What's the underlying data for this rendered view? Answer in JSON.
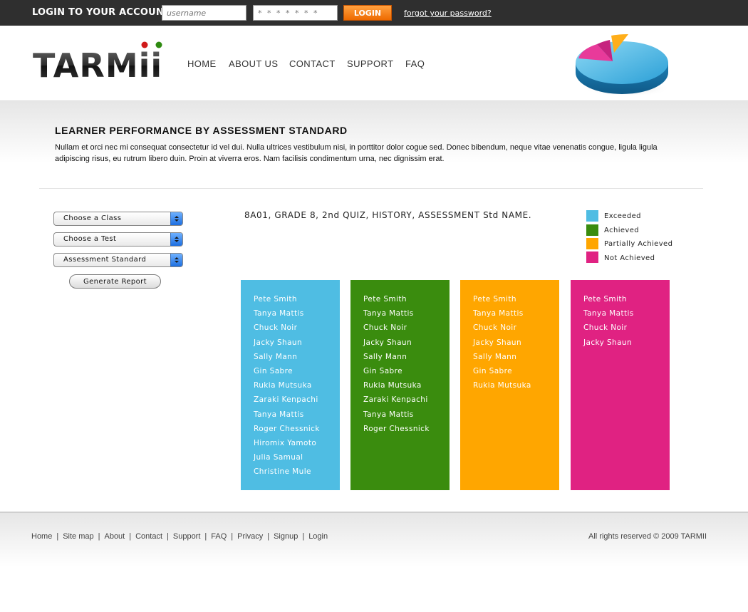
{
  "login": {
    "title": "LOGIN TO YOUR ACCOUNT",
    "username_placeholder": "username",
    "password_placeholder": "* * * * * * *",
    "button_label": "LOGIN",
    "forgot_label": "forgot your password?"
  },
  "brand": {
    "logo_text": "TARMii"
  },
  "nav": [
    "HOME",
    "ABOUT US",
    "CONTACT",
    "SUPPORT",
    "FAQ"
  ],
  "page": {
    "title": "LEARNER PERFORMANCE BY ASSESSMENT STANDARD",
    "description": "Nullam et orci nec mi consequat consectetur id vel dui. Nulla ultrices vestibulum nisi, in porttitor dolor cogue sed. Donec bibendum, neque vitae venenatis congue, ligula ligula adipiscing risus, eu rutrum libero duin. Proin at viverra eros. Nam facilisis condimentum urna, nec dignissim erat."
  },
  "filters": {
    "class_select": "Choose a Class",
    "test_select": "Choose a Test",
    "standard_select": "Assessment Standard",
    "generate_button": "Generate Report"
  },
  "report": {
    "title": "8A01, GRADE 8, 2nd QUIZ, HISTORY, ASSESSMENT Std NAME.",
    "legend": [
      {
        "label": "Exceeded",
        "color": "#4fbde3"
      },
      {
        "label": "Achieved",
        "color": "#3a8c0e"
      },
      {
        "label": "Partially Achieved",
        "color": "#ffa600"
      },
      {
        "label": "Not Achieved",
        "color": "#e02282"
      }
    ],
    "columns": [
      {
        "color": "#4fbde3",
        "learners": [
          "Pete Smith",
          "Tanya Mattis",
          "Chuck Noir",
          "Jacky Shaun",
          "Sally Mann",
          "Gin Sabre",
          "Rukia Mutsuka",
          "Zaraki Kenpachi",
          "Tanya Mattis",
          "Roger Chessnick",
          "Hiromix Yamoto",
          "Julia Samual",
          "Christine Mule"
        ]
      },
      {
        "color": "#3a8c0e",
        "learners": [
          "Pete Smith",
          "Tanya Mattis",
          "Chuck Noir",
          "Jacky Shaun",
          "Sally Mann",
          "Gin Sabre",
          "Rukia Mutsuka",
          "Zaraki Kenpachi",
          "Tanya Mattis",
          "Roger Chessnick"
        ]
      },
      {
        "color": "#ffa600",
        "learners": [
          "Pete Smith",
          "Tanya Mattis",
          "Chuck Noir",
          "Jacky Shaun",
          "Sally Mann",
          "Gin Sabre",
          "Rukia Mutsuka"
        ]
      },
      {
        "color": "#e02282",
        "learners": [
          "Pete Smith",
          "Tanya Mattis",
          "Chuck Noir",
          "Jacky Shaun"
        ]
      }
    ]
  },
  "footer": {
    "links": [
      "Home",
      "Site map",
      "About",
      "Contact",
      "Support",
      "FAQ",
      "Privacy",
      "Signup",
      "Login"
    ],
    "copyright": "All rights reserved © 2009 TARMII"
  },
  "icons": {
    "logo": "tarmii-logo",
    "header_art": "pie-chart-icon",
    "select_arrow": "updown-arrow-icon"
  }
}
